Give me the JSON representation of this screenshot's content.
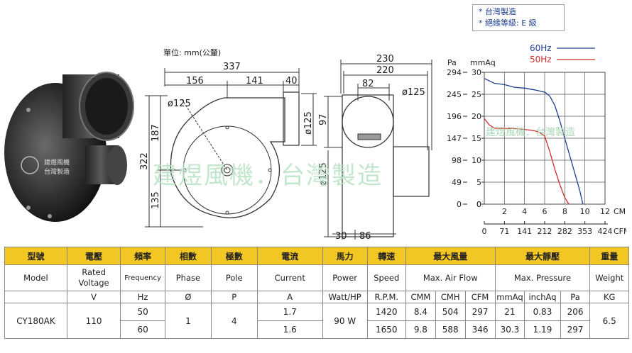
{
  "notes": [
    "* 台灣製造",
    "* 絕緣等級: E 級"
  ],
  "units_label": "單位: mm(公釐)",
  "photo": {
    "caption_lines": [
      "建",
      "煜",
      "風",
      "機",
      "台",
      "灣",
      "製",
      "造"
    ]
  },
  "watermark": "建煜風機．台灣製造",
  "dimensions": {
    "front": {
      "total_width": "337",
      "part_a": "156",
      "part_b": "141",
      "part_c": "40",
      "diameter_label": "ø125",
      "height_total": "322",
      "height_upper": "187",
      "height_lower": "135",
      "outlet_height": "ø125"
    },
    "side": {
      "width_outer": "230",
      "width_inner": "220",
      "top_width": "82",
      "outlet_diameter": "ø125",
      "offset_97": "97",
      "inlet_diameter": "ø125",
      "bottom_a": "30",
      "bottom_b": "86"
    }
  },
  "chart_data": {
    "type": "line",
    "series": [
      {
        "name": "60Hz",
        "color": "#1e3f8f",
        "x": [
          0,
          1,
          2,
          3,
          4,
          5,
          6,
          6.5,
          7,
          7.5,
          8,
          8.5,
          9,
          9.5,
          9.8
        ],
        "y": [
          28.6,
          27.5,
          27.2,
          26.6,
          26.4,
          26.0,
          25.5,
          24.6,
          22.5,
          19.0,
          15.0,
          11.0,
          7.0,
          3.0,
          0
        ]
      },
      {
        "name": "50Hz",
        "color": "#d62b2b",
        "x": [
          0,
          0.5,
          1,
          2,
          3,
          4,
          5,
          5.5,
          6,
          6.5,
          7,
          7.5,
          8,
          8.4
        ],
        "y": [
          19.5,
          18.0,
          17.3,
          17.2,
          17.2,
          17.0,
          16.7,
          16.3,
          15.5,
          12.0,
          8.0,
          4.5,
          1.5,
          0
        ]
      }
    ],
    "xlabel_top": "CMM",
    "xlabel_bottom": "CFM",
    "ylabel_left": "Pa",
    "ylabel_right": "mmAq",
    "x_ticks": [
      "0",
      "2",
      "4",
      "6",
      "8",
      "10",
      "12"
    ],
    "x_cfm_ticks": [
      "0",
      "71",
      "141",
      "212",
      "282",
      "353",
      "424"
    ],
    "y_mmaq_ticks": [
      "0",
      "5",
      "10",
      "15",
      "20",
      "25",
      "30"
    ],
    "y_pa_ticks": [
      "0",
      "49",
      "98",
      "147",
      "196",
      "245",
      "294"
    ],
    "xlim": [
      0,
      12
    ],
    "ylim": [
      0,
      30
    ],
    "grid": true,
    "watermark": "建煜風機．台灣製造"
  },
  "table": {
    "zh_headers": [
      "型號",
      "電壓",
      "頻率",
      "相數",
      "極數",
      "電流",
      "馬力",
      "轉速",
      "最大風量",
      "最大靜壓",
      "重量"
    ],
    "en_headers": {
      "model": "Model",
      "voltage": "Rated Voltage",
      "frequency": "Frequency",
      "phase": "Phase",
      "pole": "Pole",
      "current": "Current",
      "power": "Power",
      "speed": "Speed",
      "air_flow": "Max. Air Flow",
      "pressure": "Max. Pressure",
      "weight": "Weight"
    },
    "units": [
      "V",
      "Hz",
      "Ø",
      "P",
      "A",
      "Watt/HP",
      "R.P.M.",
      "CMM",
      "CMH",
      "CFM",
      "mmAq",
      "inchAq",
      "Pa",
      "KG"
    ],
    "model": "CY180AK",
    "voltage": "110",
    "phase": "1",
    "pole": "4",
    "power": "90 W",
    "weight": "6.5",
    "rows": [
      {
        "freq": "50",
        "current": "1.7",
        "rpm": "1420",
        "cmm": "8.4",
        "cmh": "504",
        "cfm": "297",
        "mmaq": "21",
        "inchaq": "0.83",
        "pa": "206"
      },
      {
        "freq": "60",
        "current": "1.6",
        "rpm": "1650",
        "cmm": "9.8",
        "cmh": "588",
        "cfm": "346",
        "mmaq": "30.3",
        "inchaq": "1.19",
        "pa": "297"
      }
    ]
  }
}
